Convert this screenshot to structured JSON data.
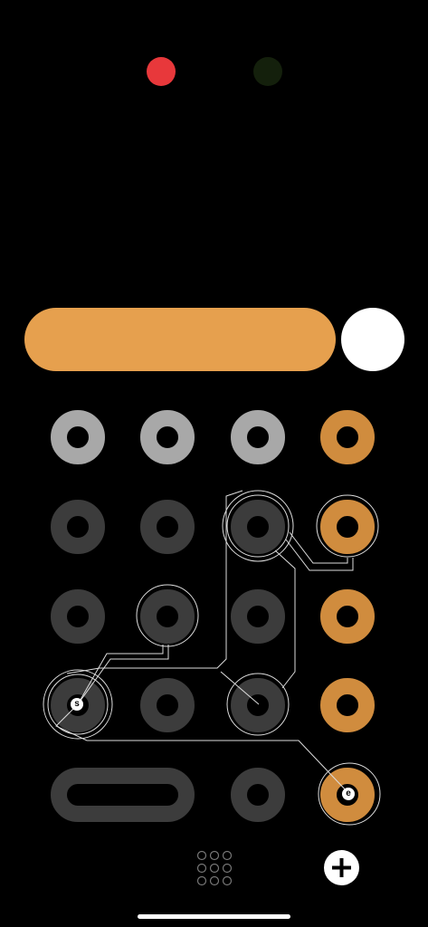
{
  "colors": {
    "background": "#000000",
    "indicator_red": "#e8383b",
    "indicator_green": "#14200c",
    "accent_orange": "#e6a04e",
    "key_orange": "#d08c3e",
    "key_light": "#a8a8a8",
    "key_dark": "#3c3c3c",
    "knob_white": "#ffffff",
    "wire": "#dddddd"
  },
  "indicators": [
    {
      "name": "indicator-red",
      "icon": "red-dot-icon"
    },
    {
      "name": "indicator-green",
      "icon": "green-dot-icon"
    }
  ],
  "display": {
    "bar": "orange-progress-bar",
    "knob": "white-knob"
  },
  "keypad": {
    "rows": [
      [
        "light",
        "light",
        "light",
        "orange"
      ],
      [
        "dark",
        "dark",
        "dark",
        "orange"
      ],
      [
        "dark",
        "dark",
        "dark",
        "orange"
      ],
      [
        "dark",
        "dark",
        "dark",
        "orange"
      ],
      [
        "dark-wide",
        "dark",
        "orange"
      ]
    ]
  },
  "path": {
    "start_label": "s",
    "end_label": "e"
  },
  "toolbar": {
    "grid_icon": "grid-menu-icon",
    "add_icon": "plus-icon"
  }
}
